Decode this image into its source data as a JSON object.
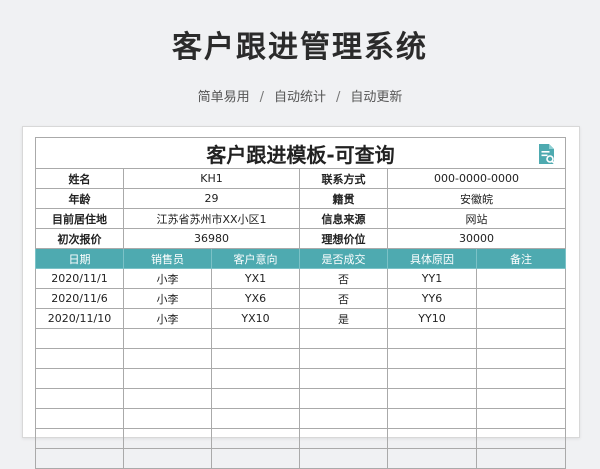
{
  "header": {
    "title": "客户跟进管理系统",
    "features": [
      "简单易用",
      "自动统计",
      "自动更新"
    ],
    "separator": "/"
  },
  "sheet": {
    "title": "客户跟进模板-可查询",
    "info": [
      {
        "label": "姓名",
        "value": "KH1",
        "label2": "联系方式",
        "value2": "000-0000-0000"
      },
      {
        "label": "年龄",
        "value": "29",
        "label2": "籍贯",
        "value2": "安徽皖"
      },
      {
        "label": "目前居住地",
        "value": "江苏省苏州市XX小区1",
        "label2": "信息来源",
        "value2": "网站"
      },
      {
        "label": "初次报价",
        "value": "36980",
        "label2": "理想价位",
        "value2": "30000"
      }
    ],
    "columns": [
      "日期",
      "销售员",
      "客户意向",
      "是否成交",
      "具体原因",
      "备注"
    ],
    "rows": [
      [
        "2020/11/1",
        "小李",
        "YX1",
        "否",
        "YY1",
        ""
      ],
      [
        "2020/11/6",
        "小李",
        "YX6",
        "否",
        "YY6",
        ""
      ],
      [
        "2020/11/10",
        "小李",
        "YX10",
        "是",
        "YY10",
        ""
      ]
    ],
    "empty_rows": 7,
    "header_color": "#4eaab0"
  }
}
